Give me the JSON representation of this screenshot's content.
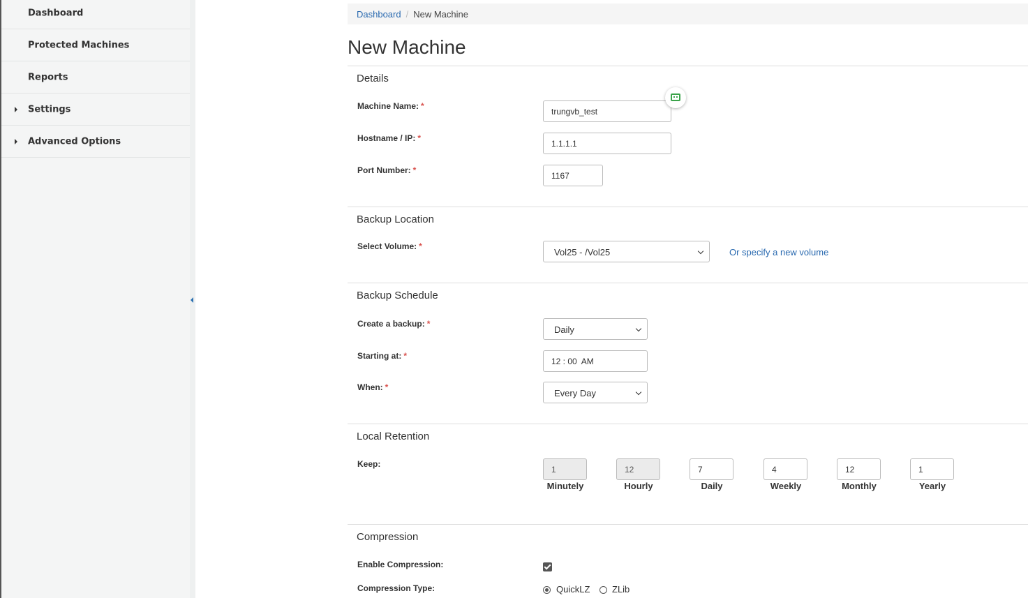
{
  "sidebar": {
    "items": [
      {
        "label": "Dashboard",
        "has_caret": false
      },
      {
        "label": "Protected Machines",
        "has_caret": false
      },
      {
        "label": "Reports",
        "has_caret": false
      },
      {
        "label": "Settings",
        "has_caret": true
      },
      {
        "label": "Advanced Options",
        "has_caret": true
      }
    ]
  },
  "breadcrumb": {
    "root": "Dashboard",
    "separator": "/",
    "current": "New Machine"
  },
  "page": {
    "title": "New Machine"
  },
  "details": {
    "title": "Details",
    "machine_name": {
      "label": "Machine Name:",
      "value": "trungvb_test"
    },
    "hostname": {
      "label": "Hostname / IP:",
      "value": "1.1.1.1"
    },
    "port": {
      "label": "Port Number:",
      "value": "1167"
    },
    "required_mark": "*"
  },
  "backup_location": {
    "title": "Backup Location",
    "select_volume": {
      "label": "Select Volume:",
      "value": "Vol25 - /Vol25"
    },
    "new_volume_link": "Or specify a new volume"
  },
  "backup_schedule": {
    "title": "Backup Schedule",
    "create": {
      "label": "Create a backup:",
      "value": "Daily"
    },
    "starting": {
      "label": "Starting at:",
      "value": "12 : 00  AM"
    },
    "when": {
      "label": "When:",
      "value": "Every Day"
    }
  },
  "local_retention": {
    "title": "Local Retention",
    "keep_label": "Keep:",
    "fields": [
      {
        "label": "Minutely",
        "value": "1",
        "disabled": true
      },
      {
        "label": "Hourly",
        "value": "12",
        "disabled": true
      },
      {
        "label": "Daily",
        "value": "7",
        "disabled": false
      },
      {
        "label": "Weekly",
        "value": "4",
        "disabled": false
      },
      {
        "label": "Monthly",
        "value": "12",
        "disabled": false
      },
      {
        "label": "Yearly",
        "value": "1",
        "disabled": false
      }
    ]
  },
  "compression": {
    "title": "Compression",
    "enable_label": "Enable Compression:",
    "enabled": true,
    "type_label": "Compression Type:",
    "options": [
      {
        "label": "QuickLZ",
        "selected": true
      },
      {
        "label": "ZLib",
        "selected": false
      }
    ]
  },
  "colors": {
    "link": "#2a6ab0",
    "required": "#d9534f",
    "fab_icon": "#3aa34a"
  }
}
